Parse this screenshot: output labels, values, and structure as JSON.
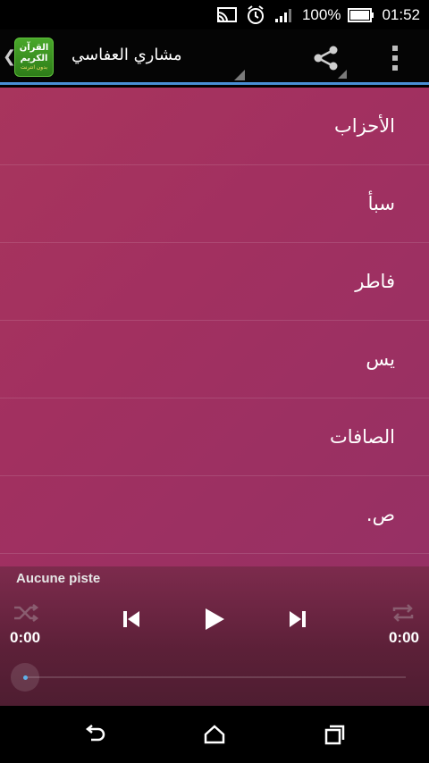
{
  "status_bar": {
    "battery": "100%",
    "time": "01:52"
  },
  "action_bar": {
    "logo_line1": "القرآن",
    "logo_line2": "الكريم",
    "logo_sub": "بدون انترنت",
    "title": "مشاري العفاسي"
  },
  "surahs": [
    {
      "label": "الأحزاب"
    },
    {
      "label": "سبأ"
    },
    {
      "label": "فاطر"
    },
    {
      "label": "يس"
    },
    {
      "label": "الصافات"
    },
    {
      "label": "ص."
    }
  ],
  "player": {
    "track_name": "Aucune piste",
    "elapsed": "0:00",
    "duration": "0:00",
    "progress": 0
  },
  "colors": {
    "accent": "#4a8fd6",
    "list_bg": "#a23060",
    "player_bg": "#5c2038"
  }
}
